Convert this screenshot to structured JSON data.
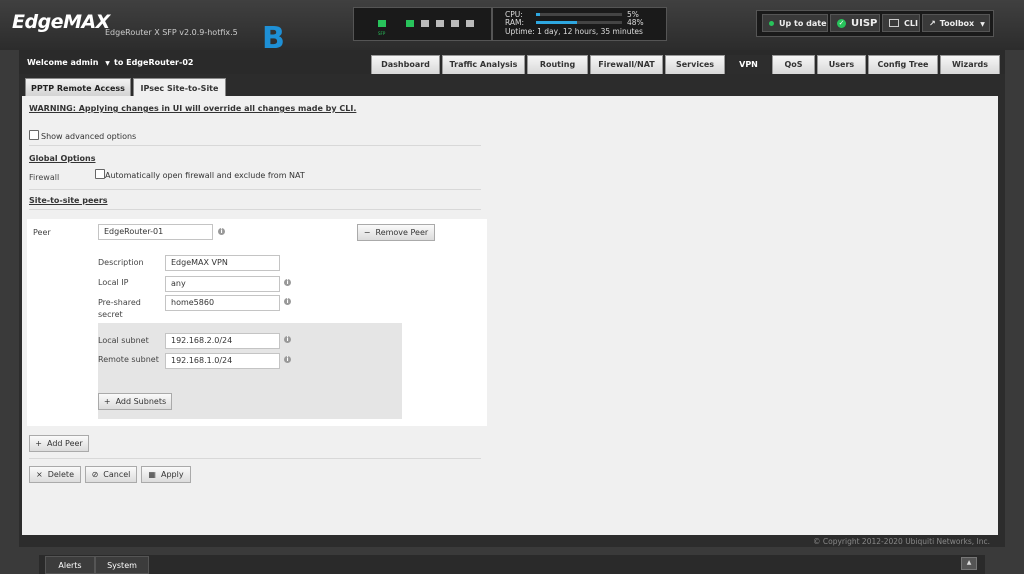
{
  "header": {
    "logo_text": "EdgeMAX",
    "device_name": "EdgeRouter X SFP v2.0.9-hotfix.5",
    "overlay_letter": "B",
    "ports_label": "SFP",
    "cpu_label": "CPU:",
    "cpu_value": "5%",
    "cpu_fraction": 0.05,
    "ram_label": "RAM:",
    "ram_value": "48%",
    "ram_fraction": 0.48,
    "uptime_label": "Uptime:",
    "uptime_value": "1 day, 12 hours, 35 minutes",
    "up_to_date": "Up to date",
    "uisp": "UISP",
    "cli": "CLI",
    "toolbox": "Toolbox"
  },
  "nav": {
    "welcome": "Welcome admin",
    "router_link": "to EdgeRouter-02",
    "tabs": [
      "Dashboard",
      "Traffic Analysis",
      "Routing",
      "Firewall/NAT",
      "Services",
      "VPN",
      "QoS",
      "Users",
      "Config Tree",
      "Wizards"
    ],
    "active_tab": "VPN"
  },
  "subtabs": [
    "PPTP Remote Access",
    "IPsec Site-to-Site"
  ],
  "active_subtab": "IPsec Site-to-Site",
  "content": {
    "warning": "WARNING: Applying changes in UI will override all changes made by CLI.",
    "show_advanced": "Show advanced options",
    "global_options": "Global Options",
    "firewall_label": "Firewall",
    "firewall_option": "Automatically open firewall and exclude from NAT",
    "site_to_site_peers": "Site-to-site peers",
    "peer": {
      "label": "Peer",
      "value": "EdgeRouter-01",
      "remove": "Remove Peer",
      "description_label": "Description",
      "description_value": "EdgeMAX VPN",
      "local_ip_label": "Local IP",
      "local_ip_value": "any",
      "psk_label": "Pre-shared secret",
      "psk_value": "home5860",
      "local_subnet_label": "Local subnet",
      "local_subnet_value": "192.168.2.0/24",
      "remote_subnet_label": "Remote subnet",
      "remote_subnet_value": "192.168.1.0/24",
      "add_subnets": "Add Subnets"
    },
    "add_peer": "Add Peer",
    "delete": "Delete",
    "cancel": "Cancel",
    "apply": "Apply"
  },
  "footer": {
    "copyright": "© Copyright 2012-2020 Ubiquiti Networks, Inc."
  },
  "bottom_tabs": [
    "Alerts",
    "System"
  ]
}
